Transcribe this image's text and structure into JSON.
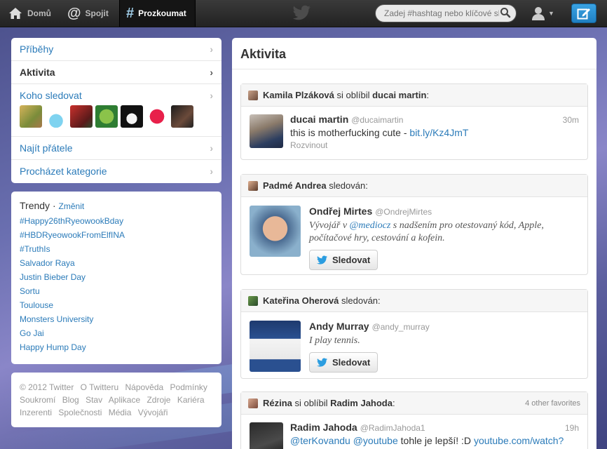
{
  "nav": {
    "home": "Domů",
    "connect": "Spojit",
    "discover": "Prozkoumat"
  },
  "search": {
    "placeholder": "Zadej #hashtag nebo klíčové slovo"
  },
  "sidebar": {
    "items": {
      "stories": "Příběhy",
      "activity": "Aktivita",
      "who_to_follow": "Koho sledovat",
      "find_friends": "Najít přátele",
      "browse": "Procházet kategorie"
    }
  },
  "trends": {
    "title": "Trendy",
    "change": "Změnit",
    "items": [
      "#Happy26thRyeowookBday",
      "#HBDRyeowookFromElfINA",
      "#TruthIs",
      "Salvador Raya",
      "Justin Bieber Day",
      "Sortu",
      "Toulouse",
      "Monsters University",
      "Go Jai",
      "Happy Hump Day"
    ]
  },
  "footer": {
    "line1": [
      "© 2012 Twitter",
      "O Twitteru",
      "Nápověda",
      "Podmínky"
    ],
    "line2": [
      "Soukromí",
      "Blog",
      "Stav",
      "Aplikace",
      "Zdroje",
      "Kariéra"
    ],
    "line3": [
      "Inzerenti",
      "Společnosti",
      "Média",
      "Vývojáři"
    ]
  },
  "main": {
    "title": "Aktivita",
    "cards": [
      {
        "actor": "Kamila Plzáková",
        "action": "si oblíbil",
        "target": "ducai martin",
        "suffix": ":",
        "tweet": {
          "name": "ducai martin",
          "handle": "@ducaimartin",
          "time": "30m",
          "text": "this is motherfucking cute - ",
          "link": "bit.ly/Kz4JmT",
          "expand": "Rozvinout"
        }
      },
      {
        "actor": "Padmé Andrea",
        "action": "sledován:",
        "profile": {
          "name": "Ondřej Mirtes",
          "handle": "@OndrejMirtes",
          "bio_pre": "Vývojář v ",
          "bio_link": "@mediocz",
          "bio_post": " s nadšením pro otestovaný kód, Apple, počítačové hry, cestování a kofein.",
          "button": "Sledovat"
        }
      },
      {
        "actor": "Kateřina Oherová",
        "action": "sledován:",
        "profile": {
          "name": "Andy Murray",
          "handle": "@andy_murray",
          "bio": "I play tennis.",
          "button": "Sledovat"
        }
      },
      {
        "actor": "Rézina",
        "action": "si oblíbil",
        "target": "Radim Jahoda",
        "suffix": ":",
        "extra": "4 other favorites",
        "tweet": {
          "name": "Radim Jahoda",
          "handle": "@RadimJahoda1",
          "time": "19h",
          "mention1": "@terKovandu",
          "mention2": "@youtube",
          "text": " tohle je lepší! :D ",
          "link": "youtube.com/watch?"
        }
      }
    ]
  },
  "colors": {
    "link": "#2b7bb9",
    "topbar": "#2a2a2a",
    "compose": "#2b8fd4"
  }
}
